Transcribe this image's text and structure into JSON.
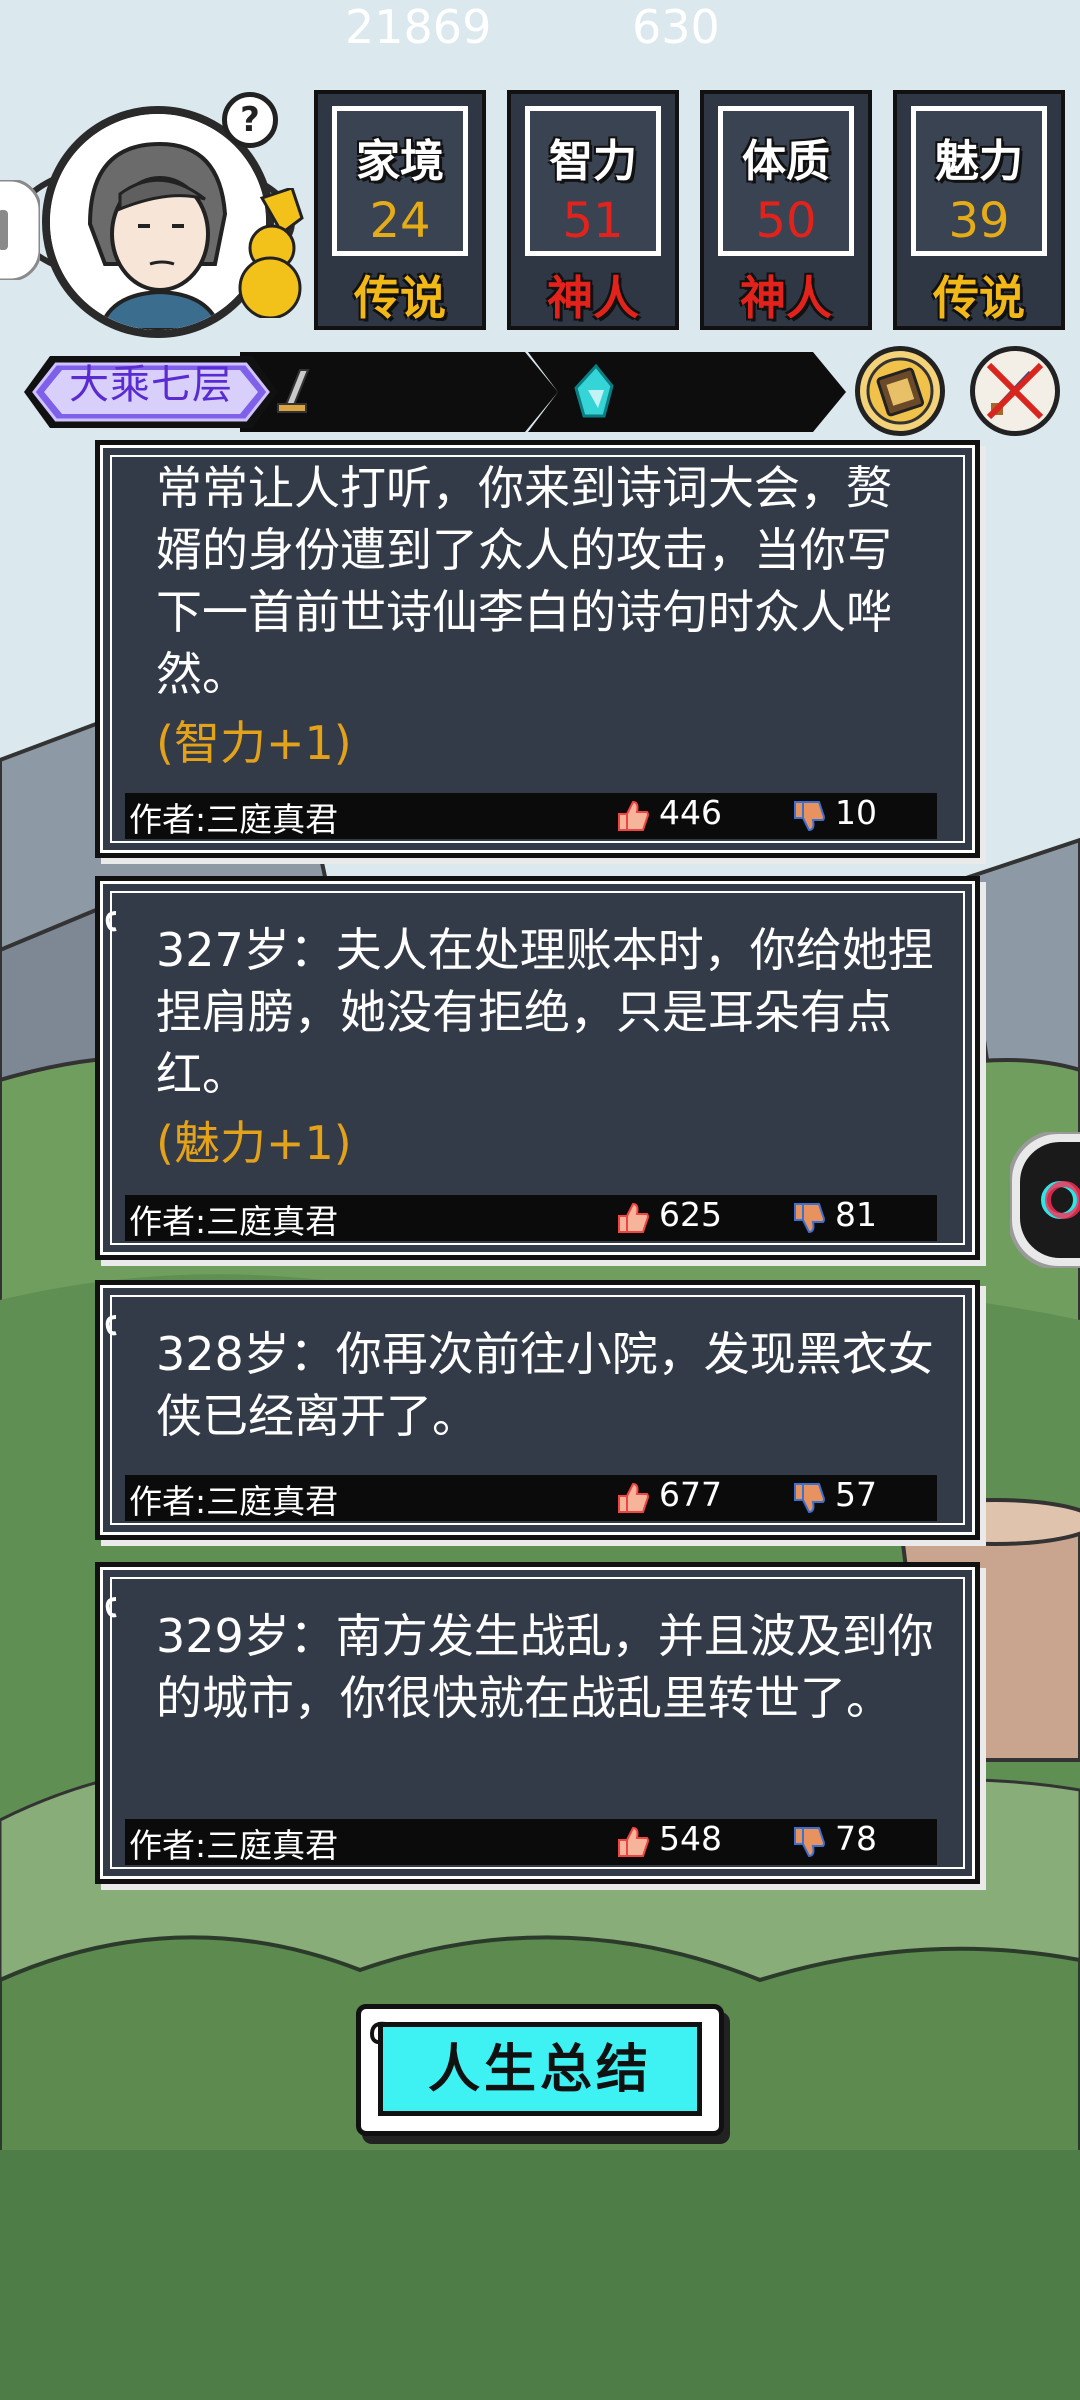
{
  "header": {
    "help_icon_text": "?",
    "stats": [
      {
        "label": "家境",
        "value": "24",
        "tier": "传说",
        "value_color": "#e5ac17",
        "tier_color": "#f2b817"
      },
      {
        "label": "智力",
        "value": "51",
        "tier": "神人",
        "value_color": "#e3231b",
        "tier_color": "#e3231b"
      },
      {
        "label": "体质",
        "value": "50",
        "tier": "神人",
        "value_color": "#e3231b",
        "tier_color": "#e3231b"
      },
      {
        "label": "魅力",
        "value": "39",
        "tier": "传说",
        "value_color": "#e5ac17",
        "tier_color": "#f2b817"
      }
    ],
    "realm": "大乘七层",
    "combat_power": "21869",
    "spirit_stones": "630",
    "backpack_icon": "scroll-book-icon",
    "close_icon": "crossed-sword-icon"
  },
  "events": [
    {
      "text": "常常让人打听，你来到诗词大会，赘婿的身份遭到了众人的攻击，当你写下一首前世诗仙李白的诗句时众人哗然。",
      "bonus": "(智力+1)",
      "author": "作者:三庭真君",
      "likes": "446",
      "dislikes": "10"
    },
    {
      "text": "327岁：夫人在处理账本时，你给她捏捏肩膀，她没有拒绝，只是耳朵有点红。",
      "bonus": "(魅力+1)",
      "author": "作者:三庭真君",
      "likes": "625",
      "dislikes": "81"
    },
    {
      "text": "328岁：你再次前往小院，发现黑衣女侠已经离开了。",
      "bonus": "",
      "author": "作者:三庭真君",
      "likes": "677",
      "dislikes": "57"
    },
    {
      "text": "329岁：南方发生战乱，并且波及到你的城市，你很快就在战乱里转世了。",
      "bonus": "",
      "author": "作者:三庭真君",
      "likes": "548",
      "dislikes": "78"
    }
  ],
  "summary_button": "人生总结",
  "colors": {
    "card_bg": "#333b48",
    "bonus": "#e4a21a",
    "summary_bg": "#3ef1f3",
    "realm_text": "#5a2bd0"
  }
}
